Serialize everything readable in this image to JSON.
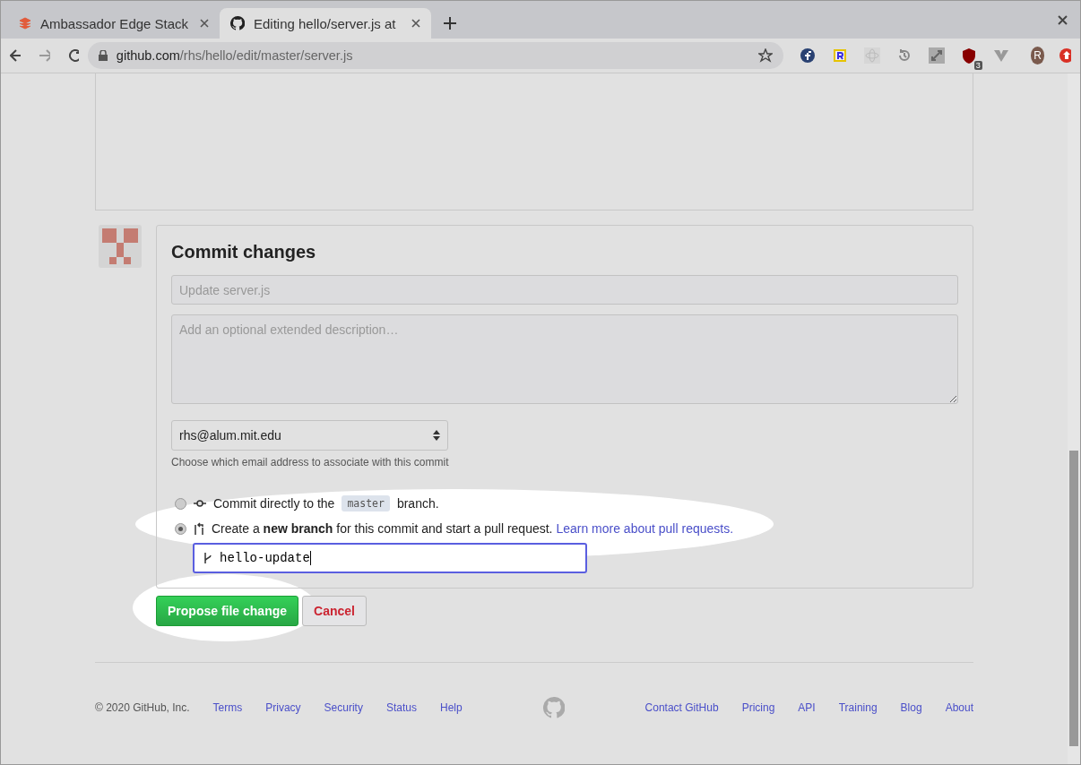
{
  "browser": {
    "tabs": [
      {
        "title": "Ambassador Edge Stack",
        "selected": false,
        "kind": "ambassador"
      },
      {
        "title": "Editing hello/server.js at",
        "selected": true,
        "kind": "github"
      }
    ],
    "url_host": "github.com",
    "url_path": "/rhs/hello/edit/master/server.js",
    "extensions": [
      {
        "kind": "fedora"
      },
      {
        "kind": "r"
      },
      {
        "kind": "atom"
      },
      {
        "kind": "history"
      },
      {
        "kind": "expand"
      },
      {
        "kind": "shield",
        "badge": "3"
      },
      {
        "kind": "v"
      }
    ],
    "profile": "R"
  },
  "commit": {
    "title": "Commit changes",
    "summary_placeholder": "Update server.js",
    "description_placeholder": "Add an optional extended description…",
    "email": "rhs@alum.mit.edu",
    "email_hint": "Choose which email address to associate with this commit",
    "options": [
      {
        "kind": "direct",
        "selected": false,
        "text_before": "Commit directly to the",
        "branch": "master",
        "text_after": "branch."
      },
      {
        "kind": "new",
        "selected": true,
        "text": "Create a **new branch** for this commit and start a pull request.",
        "link": "Learn more about pull requests."
      }
    ],
    "branch_name": "hello-update",
    "buttons": [
      {
        "kind": "primary",
        "label": "Propose file change"
      },
      {
        "kind": "cancel",
        "label": "Cancel"
      }
    ]
  },
  "footer": {
    "copyright": "© 2020 GitHub, Inc.",
    "left_links": [
      "Terms",
      "Privacy",
      "Security",
      "Status",
      "Help"
    ],
    "right_links": [
      "Contact GitHub",
      "Pricing",
      "API",
      "Training",
      "Blog",
      "About"
    ]
  }
}
